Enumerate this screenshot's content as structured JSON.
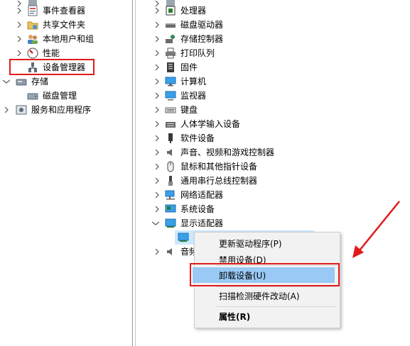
{
  "left_tree": [
    {
      "label": "",
      "icon": "device-icon"
    },
    {
      "label": "事件查看器",
      "icon": "event-viewer-icon"
    },
    {
      "label": "共享文件夹",
      "icon": "shared-folder-icon"
    },
    {
      "label": "本地用户和组",
      "icon": "users-icon"
    },
    {
      "label": "性能",
      "icon": "performance-icon"
    },
    {
      "label": "设备管理器",
      "icon": "device-manager-icon"
    },
    {
      "label": "存储",
      "icon": "storage-icon"
    },
    {
      "label": "磁盘管理",
      "icon": "disk-icon"
    },
    {
      "label": "服务和应用程序",
      "icon": "services-icon"
    }
  ],
  "right_tree": [
    {
      "label": "",
      "icon": "device-icon"
    },
    {
      "label": "处理器",
      "icon": "processor-icon"
    },
    {
      "label": "磁盘驱动器",
      "icon": "disk-drive-icon"
    },
    {
      "label": "存储控制器",
      "icon": "storage-controller-icon"
    },
    {
      "label": "打印队列",
      "icon": "printer-icon"
    },
    {
      "label": "固件",
      "icon": "firmware-icon"
    },
    {
      "label": "计算机",
      "icon": "computer-icon"
    },
    {
      "label": "监视器",
      "icon": "monitor-icon"
    },
    {
      "label": "键盘",
      "icon": "keyboard-icon"
    },
    {
      "label": "人体学输入设备",
      "icon": "hid-icon"
    },
    {
      "label": "软件设备",
      "icon": "software-device-icon"
    },
    {
      "label": "声音、视频和游戏控制器",
      "icon": "sound-icon"
    },
    {
      "label": "鼠标和其他指针设备",
      "icon": "mouse-icon"
    },
    {
      "label": "通用串行总线控制器",
      "icon": "usb-icon"
    },
    {
      "label": "网络适配器",
      "icon": "network-icon"
    },
    {
      "label": "系统设备",
      "icon": "system-device-icon"
    },
    {
      "label": "显示适配器",
      "icon": "display-adapter-icon"
    },
    {
      "label": "",
      "icon": "display-adapter-icon"
    },
    {
      "label": "音频",
      "icon": "audio-icon"
    }
  ],
  "context_menu": {
    "items": [
      {
        "label": "更新驱动程序(P)"
      },
      {
        "label": "禁用设备(D)"
      },
      {
        "label": "卸载设备(U)"
      },
      {
        "label": "扫描检测硬件改动(A)"
      },
      {
        "label": "属性(R)"
      }
    ]
  },
  "colors": {
    "highlight": "#99c9f4",
    "red": "#e01b1b",
    "menu_bg": "#f2f2f2",
    "selection_bg": "#cce8ff"
  }
}
